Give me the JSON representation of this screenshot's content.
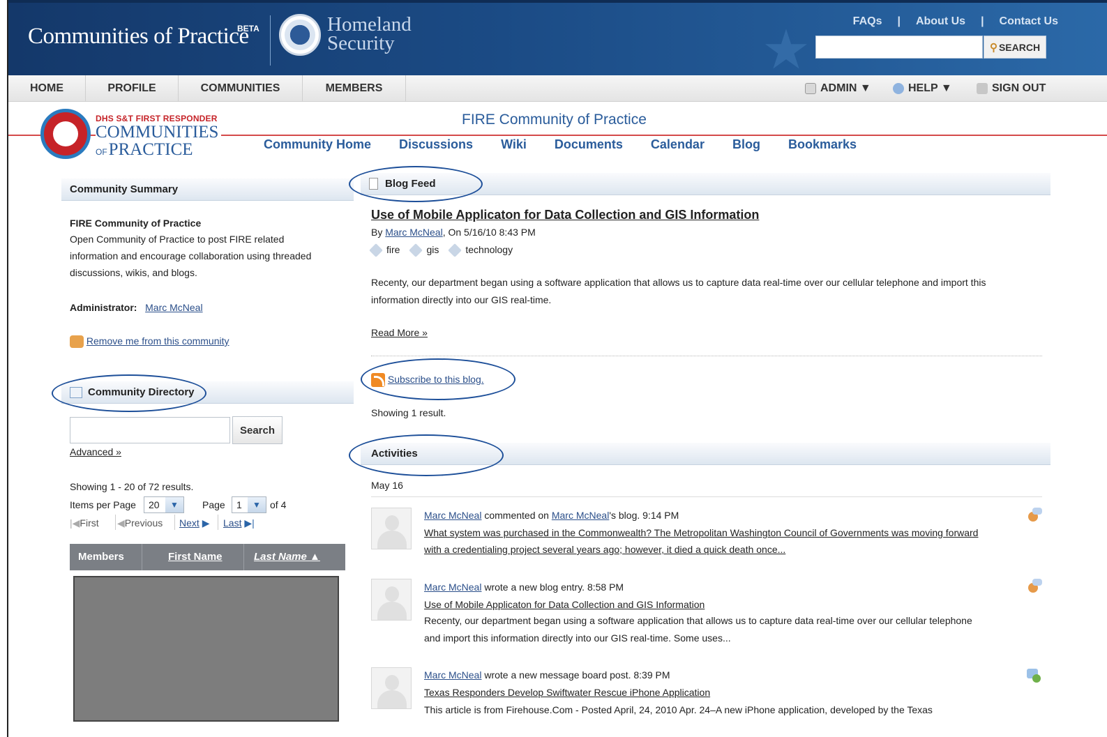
{
  "header": {
    "app_title": "Communities of Practice",
    "beta": "BETA",
    "agency_line1": "Homeland",
    "agency_line2": "Security",
    "top_links": [
      "FAQs",
      "About Us",
      "Contact Us"
    ],
    "search_button": "SEARCH",
    "search_value": ""
  },
  "nav": {
    "items": [
      "HOME",
      "PROFILE",
      "COMMUNITIES",
      "MEMBERS"
    ],
    "admin": "ADMIN ▼",
    "help": "HELP ▼",
    "sign_out": "SIGN OUT"
  },
  "community": {
    "logo_sub": "DHS S&T FIRST RESPONDER",
    "logo_big": "COMMUNITIES",
    "logo_of": "OF",
    "logo_big2": "PRACTICE",
    "title": "FIRE Community of Practice",
    "subnav": [
      "Community Home",
      "Discussions",
      "Wiki",
      "Documents",
      "Calendar",
      "Blog",
      "Bookmarks"
    ]
  },
  "summary": {
    "heading": "Community Summary",
    "name": "FIRE Community of Practice",
    "description": "Open Community of Practice to post FIRE related information and encourage collaboration using threaded discussions, wikis, and blogs.",
    "admin_label": "Administrator:",
    "admin_name": "Marc McNeal",
    "remove_link": "Remove me from this community"
  },
  "directory": {
    "heading": "Community Directory",
    "search_button": "Search",
    "search_value": "",
    "advanced": "Advanced »",
    "showing": "Showing 1 - 20 of 72 results.",
    "items_per_page_label": "Items per Page",
    "items_per_page": "20",
    "page_label": "Page",
    "page": "1",
    "of_pages": "of 4",
    "first": "First",
    "previous": "Previous",
    "next": "Next",
    "last": "Last",
    "columns": [
      "Members",
      "First Name",
      "Last Name ▲"
    ]
  },
  "blog": {
    "heading": "Blog Feed",
    "post_title": "Use of Mobile Applicaton for Data Collection and GIS Information",
    "by": "By",
    "author": "Marc McNeal",
    "date": ", On 5/16/10 8:43 PM",
    "tags": [
      "fire",
      "gis",
      "technology"
    ],
    "body_line1": "Recenty, our department began using a software application that allows us to capture data real-time over our cellular telephone and import this",
    "body_line2": "information directly into our GIS real-time.",
    "read_more": "Read More »",
    "subscribe": "Subscribe to this blog.",
    "showing": "Showing 1 result."
  },
  "activities": {
    "heading": "Activities",
    "date": "May 16",
    "items": [
      {
        "user": "Marc McNeal",
        "action": "commented on",
        "target": "Marc McNeal",
        "suffix": "'s blog. 9:14 PM",
        "link_line1": "What system was purchased in the Commonwealth? The Metropolitan Washington Council of Governments was moving forward",
        "link_line2": "with a credentialing project several years ago; however, it died a quick death once..."
      },
      {
        "user": "Marc McNeal",
        "action": "wrote a new blog entry. 8:58 PM",
        "link": "Use of Mobile Applicaton for Data Collection and GIS Information",
        "text_line1": "Recenty, our department began using a software application that allows us to capture data real-time over our cellular telephone",
        "text_line2": "and import this information directly into our GIS real-time. Some uses..."
      },
      {
        "user": "Marc McNeal",
        "action": "wrote a new message board post. 8:39 PM",
        "link": "Texas Responders Develop Swiftwater Rescue iPhone Application",
        "text_line1": "This article is from Firehouse.Com - Posted April, 24, 2010 Apr. 24–A new iPhone application, developed by the Texas"
      }
    ]
  }
}
